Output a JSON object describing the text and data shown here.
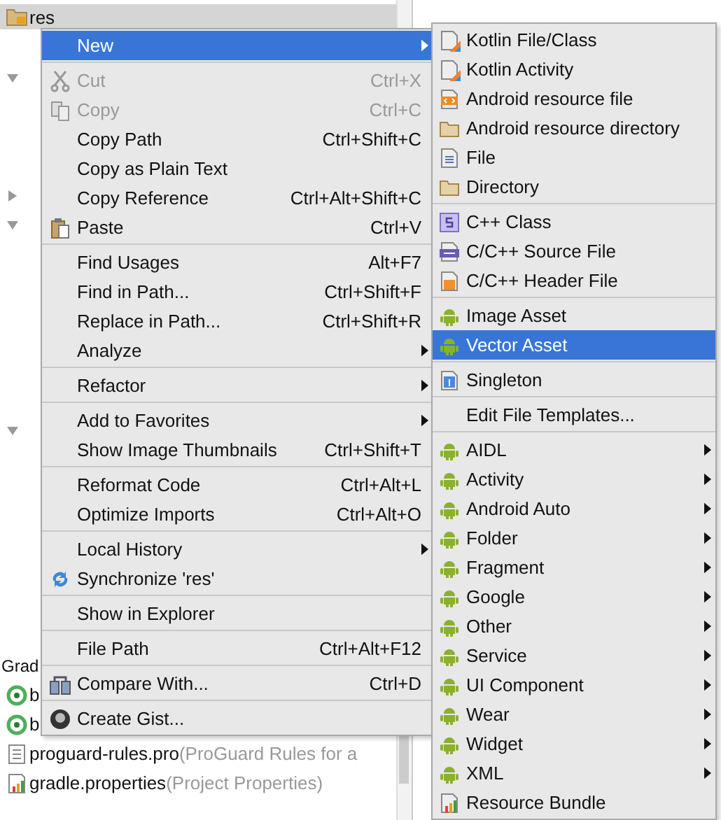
{
  "project_tree": {
    "rows": [
      {
        "kind": "res",
        "label": "res"
      },
      {
        "kind": "hidden"
      },
      {
        "kind": "toggle",
        "expanded": true
      },
      {
        "kind": "hidden"
      },
      {
        "kind": "hidden"
      },
      {
        "kind": "hidden"
      },
      {
        "kind": "toggle",
        "expanded": false
      },
      {
        "kind": "toggle",
        "expanded": true
      },
      {
        "kind": "hidden"
      },
      {
        "kind": "hidden"
      },
      {
        "kind": "hidden"
      },
      {
        "kind": "hidden"
      },
      {
        "kind": "hidden"
      },
      {
        "kind": "hidden"
      },
      {
        "kind": "toggle",
        "expanded": true
      },
      {
        "kind": "hidden"
      },
      {
        "kind": "hidden"
      },
      {
        "kind": "hidden"
      },
      {
        "kind": "hidden"
      },
      {
        "kind": "hidden"
      },
      {
        "kind": "hidden"
      },
      {
        "kind": "hidden"
      },
      {
        "kind": "header",
        "label": "Grad"
      },
      {
        "kind": "gradle",
        "label": "b"
      },
      {
        "kind": "gradle",
        "label": "b"
      },
      {
        "kind": "text-file",
        "label": "proguard-rules.pro",
        "hint": "(ProGuard Rules for a"
      },
      {
        "kind": "properties",
        "label": "gradle.properties",
        "hint": "(Project Properties)"
      }
    ]
  },
  "context_menu": {
    "groups": [
      {
        "items": [
          {
            "label": "New",
            "kind": "plain",
            "submenu": true,
            "disabled": false,
            "selected": true
          }
        ]
      },
      {
        "items": [
          {
            "label": "Cut",
            "shortcut": "Ctrl+X",
            "kind": "cut",
            "submenu": false,
            "disabled": true,
            "selected": false
          },
          {
            "label": "Copy",
            "shortcut": "Ctrl+C",
            "kind": "copy",
            "submenu": false,
            "disabled": true,
            "selected": false
          },
          {
            "label": "Copy Path",
            "shortcut": "Ctrl+Shift+C",
            "kind": "plain",
            "submenu": false,
            "disabled": false,
            "selected": false
          },
          {
            "label": "Copy as Plain Text",
            "kind": "plain",
            "submenu": false,
            "disabled": false,
            "selected": false
          },
          {
            "label": "Copy Reference",
            "shortcut": "Ctrl+Alt+Shift+C",
            "kind": "plain",
            "submenu": false,
            "disabled": false,
            "selected": false
          },
          {
            "label": "Paste",
            "shortcut": "Ctrl+V",
            "kind": "paste",
            "submenu": false,
            "disabled": false,
            "selected": false
          }
        ]
      },
      {
        "items": [
          {
            "label": "Find Usages",
            "shortcut": "Alt+F7",
            "kind": "plain",
            "submenu": false,
            "disabled": false,
            "selected": false
          },
          {
            "label": "Find in Path...",
            "shortcut": "Ctrl+Shift+F",
            "kind": "plain",
            "submenu": false,
            "disabled": false,
            "selected": false
          },
          {
            "label": "Replace in Path...",
            "shortcut": "Ctrl+Shift+R",
            "kind": "plain",
            "submenu": false,
            "disabled": false,
            "selected": false
          },
          {
            "label": "Analyze",
            "kind": "plain",
            "submenu": true,
            "disabled": false,
            "selected": false
          }
        ]
      },
      {
        "items": [
          {
            "label": "Refactor",
            "kind": "plain",
            "submenu": true,
            "disabled": false,
            "selected": false
          }
        ]
      },
      {
        "items": [
          {
            "label": "Add to Favorites",
            "kind": "plain",
            "submenu": true,
            "disabled": false,
            "selected": false
          },
          {
            "label": "Show Image Thumbnails",
            "shortcut": "Ctrl+Shift+T",
            "kind": "plain",
            "submenu": false,
            "disabled": false,
            "selected": false
          }
        ]
      },
      {
        "items": [
          {
            "label": "Reformat Code",
            "shortcut": "Ctrl+Alt+L",
            "kind": "plain",
            "submenu": false,
            "disabled": false,
            "selected": false
          },
          {
            "label": "Optimize Imports",
            "shortcut": "Ctrl+Alt+O",
            "kind": "plain",
            "submenu": false,
            "disabled": false,
            "selected": false
          }
        ]
      },
      {
        "items": [
          {
            "label": "Local History",
            "kind": "plain",
            "submenu": true,
            "disabled": false,
            "selected": false
          },
          {
            "label": "Synchronize 'res'",
            "kind": "sync",
            "submenu": false,
            "disabled": false,
            "selected": false
          }
        ]
      },
      {
        "items": [
          {
            "label": "Show in Explorer",
            "kind": "plain",
            "submenu": false,
            "disabled": false,
            "selected": false
          }
        ]
      },
      {
        "items": [
          {
            "label": "File Path",
            "shortcut": "Ctrl+Alt+F12",
            "kind": "plain",
            "submenu": false,
            "disabled": false,
            "selected": false
          }
        ]
      },
      {
        "items": [
          {
            "label": "Compare With...",
            "shortcut": "Ctrl+D",
            "kind": "compare",
            "submenu": false,
            "disabled": false,
            "selected": false
          }
        ]
      },
      {
        "items": [
          {
            "label": "Create Gist...",
            "kind": "gist",
            "submenu": false,
            "disabled": false,
            "selected": false
          }
        ]
      }
    ]
  },
  "new_submenu": {
    "groups": [
      {
        "items": [
          {
            "label": "Kotlin File/Class",
            "kind": "kotlin",
            "submenu": false,
            "selected": false
          },
          {
            "label": "Kotlin Activity",
            "kind": "kotlin",
            "submenu": false,
            "selected": false
          },
          {
            "label": "Android resource file",
            "kind": "resfile",
            "submenu": false,
            "selected": false
          },
          {
            "label": "Android resource directory",
            "kind": "folder",
            "submenu": false,
            "selected": false
          },
          {
            "label": "File",
            "kind": "file",
            "submenu": false,
            "selected": false
          },
          {
            "label": "Directory",
            "kind": "folder",
            "submenu": false,
            "selected": false
          }
        ]
      },
      {
        "items": [
          {
            "label": "C++ Class",
            "kind": "cppclass",
            "submenu": false,
            "selected": false
          },
          {
            "label": "C/C++ Source File",
            "kind": "cppsource",
            "submenu": false,
            "selected": false
          },
          {
            "label": "C/C++ Header File",
            "kind": "cppheader",
            "submenu": false,
            "selected": false
          }
        ]
      },
      {
        "items": [
          {
            "label": "Image Asset",
            "kind": "android",
            "submenu": false,
            "selected": false
          },
          {
            "label": "Vector Asset",
            "kind": "android",
            "submenu": false,
            "selected": true
          }
        ]
      },
      {
        "items": [
          {
            "label": "Singleton",
            "kind": "singleton",
            "submenu": false,
            "selected": false
          }
        ]
      },
      {
        "items": [
          {
            "label": "Edit File Templates...",
            "kind": "plain",
            "submenu": false,
            "selected": false
          }
        ]
      },
      {
        "items": [
          {
            "label": "AIDL",
            "kind": "android",
            "submenu": true,
            "selected": false
          },
          {
            "label": "Activity",
            "kind": "android",
            "submenu": true,
            "selected": false
          },
          {
            "label": "Android Auto",
            "kind": "android",
            "submenu": true,
            "selected": false
          },
          {
            "label": "Folder",
            "kind": "android",
            "submenu": true,
            "selected": false
          },
          {
            "label": "Fragment",
            "kind": "android",
            "submenu": true,
            "selected": false
          },
          {
            "label": "Google",
            "kind": "android",
            "submenu": true,
            "selected": false
          },
          {
            "label": "Other",
            "kind": "android",
            "submenu": true,
            "selected": false
          },
          {
            "label": "Service",
            "kind": "android",
            "submenu": true,
            "selected": false
          },
          {
            "label": "UI Component",
            "kind": "android",
            "submenu": true,
            "selected": false
          },
          {
            "label": "Wear",
            "kind": "android",
            "submenu": true,
            "selected": false
          },
          {
            "label": "Widget",
            "kind": "android",
            "submenu": true,
            "selected": false
          },
          {
            "label": "XML",
            "kind": "android",
            "submenu": true,
            "selected": false
          },
          {
            "label": "Resource Bundle",
            "kind": "bundle",
            "submenu": false,
            "selected": false
          }
        ]
      }
    ]
  }
}
